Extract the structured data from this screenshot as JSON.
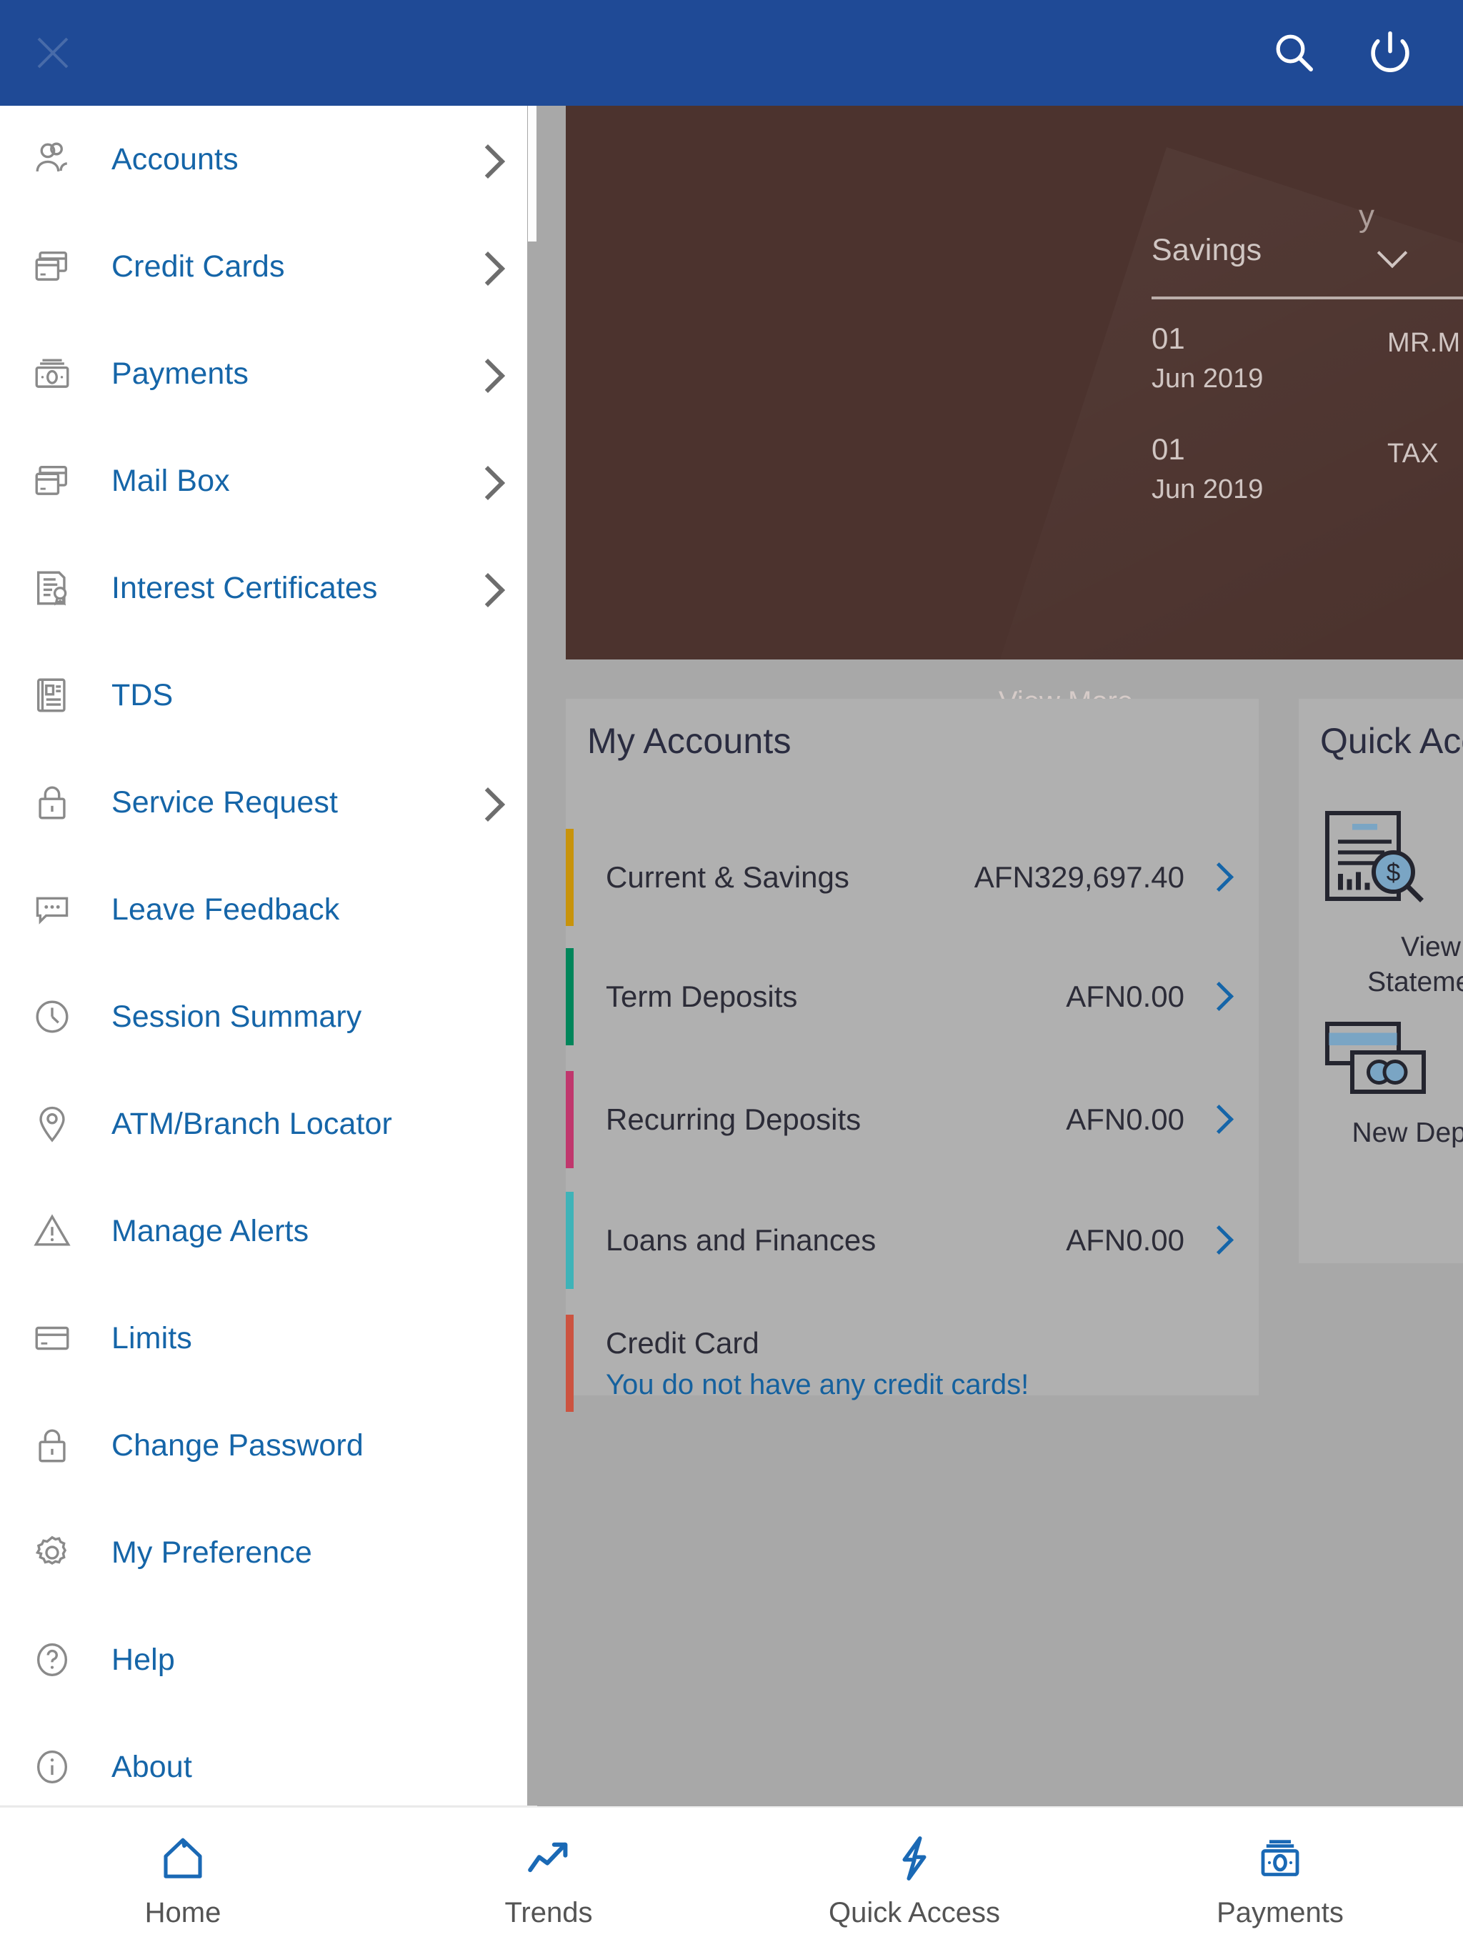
{
  "appbar": {
    "close_icon": "close-x-icon",
    "search_icon": "search-icon",
    "logout_icon": "power-logout-icon",
    "background_color": "#1f4a96"
  },
  "drawer": {
    "items": [
      {
        "label": "Accounts",
        "icon": "accounts-people-icon",
        "has_chevron": true
      },
      {
        "label": "Credit Cards",
        "icon": "credit-cards-icon",
        "has_chevron": true
      },
      {
        "label": "Payments",
        "icon": "payments-money-icon",
        "has_chevron": true
      },
      {
        "label": "Mail Box",
        "icon": "mail-box-cards-icon",
        "has_chevron": true
      },
      {
        "label": "Interest Certificates",
        "icon": "certificate-icon",
        "has_chevron": true
      },
      {
        "label": "TDS",
        "icon": "document-id-icon",
        "has_chevron": false
      },
      {
        "label": "Service Request",
        "icon": "lock-icon",
        "has_chevron": true
      },
      {
        "label": "Leave Feedback",
        "icon": "chat-bubble-icon",
        "has_chevron": false
      },
      {
        "label": "Session Summary",
        "icon": "clock-icon",
        "has_chevron": false
      },
      {
        "label": "ATM/Branch Locator",
        "icon": "map-pin-icon",
        "has_chevron": false
      },
      {
        "label": "Manage Alerts",
        "icon": "warning-triangle-icon",
        "has_chevron": false
      },
      {
        "label": "Limits",
        "icon": "card-limits-icon",
        "has_chevron": false
      },
      {
        "label": "Change Password",
        "icon": "lock-icon",
        "has_chevron": false
      },
      {
        "label": "My Preference",
        "icon": "gear-icon",
        "has_chevron": false
      },
      {
        "label": "Help",
        "icon": "question-circle-icon",
        "has_chevron": false
      },
      {
        "label": "About",
        "icon": "info-circle-icon",
        "has_chevron": false
      }
    ],
    "link_color": "#1565a8"
  },
  "transactions_card": {
    "account_selector_value": "Savings",
    "dropdown_icon": "chevron-down-icon",
    "clipped_glyph": "y",
    "rows": [
      {
        "day": "01",
        "month_year": "Jun 2019",
        "description": "MR.MILAD NABI"
      },
      {
        "day": "01",
        "month_year": "Jun 2019",
        "description": "TAX"
      }
    ],
    "view_more_label": "View More",
    "background_color": "#4c332e"
  },
  "my_accounts": {
    "title": "My Accounts",
    "rows": [
      {
        "label": "Current & Savings",
        "amount": "AFN329,697.40",
        "accent": "#c8930b",
        "has_chevron": true,
        "sub": null
      },
      {
        "label": "Term Deposits",
        "amount": "AFN0.00",
        "accent": "#00855a",
        "has_chevron": true,
        "sub": null
      },
      {
        "label": "Recurring Deposits",
        "amount": "AFN0.00",
        "accent": "#c0376d",
        "has_chevron": true,
        "sub": null
      },
      {
        "label": "Loans and Finances",
        "amount": "AFN0.00",
        "accent": "#3fb3b8",
        "has_chevron": true,
        "sub": null
      },
      {
        "label": "Credit Card",
        "amount": null,
        "accent": "#cc5340",
        "has_chevron": false,
        "sub": "You do not have any credit cards!"
      }
    ]
  },
  "quick_access": {
    "title": "Quick Access",
    "items": [
      {
        "label": "View\nStatement",
        "icon": "view-statement-icon"
      },
      {
        "label": "New Deposit",
        "icon": "new-deposit-icon"
      }
    ]
  },
  "tabbar": {
    "tabs": [
      {
        "label": "Home",
        "icon": "home-icon"
      },
      {
        "label": "Trends",
        "icon": "trends-chart-icon"
      },
      {
        "label": "Quick Access",
        "icon": "lightning-bolt-icon"
      },
      {
        "label": "Payments",
        "icon": "payments-money-icon"
      }
    ],
    "active_color": "#1a69b5"
  }
}
